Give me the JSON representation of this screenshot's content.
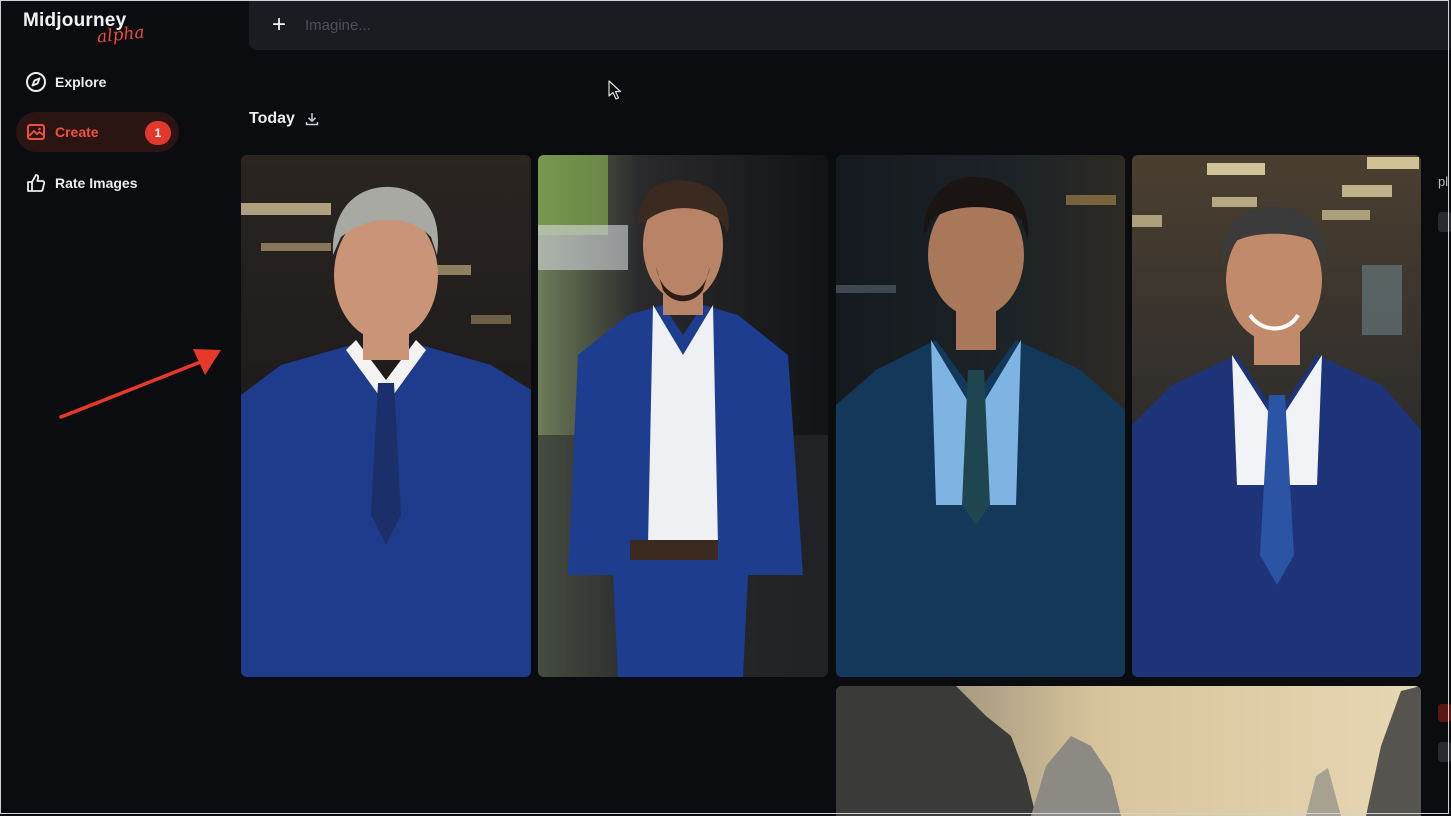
{
  "app": {
    "brand": "Midjourney",
    "badge_word": "alpha"
  },
  "sidebar": {
    "items": [
      {
        "label": "Explore",
        "icon": "compass-icon",
        "active": false
      },
      {
        "label": "Create",
        "icon": "image-icon",
        "active": true,
        "count": "1"
      },
      {
        "label": "Rate Images",
        "icon": "thumbs-up-icon",
        "active": false
      }
    ]
  },
  "prompt_bar": {
    "placeholder": "Imagine..."
  },
  "gallery": {
    "section_title": "Today",
    "download_icon": "download-icon"
  },
  "edge": {
    "partial_text": "pl"
  },
  "colors": {
    "accent": "#e2382b",
    "background": "#0b0c10",
    "prompt_bar": "#1b1c22",
    "annotation_arrow": "#e8382a"
  },
  "images": [
    {
      "name": "portrait-gray-hair-blue-suit",
      "suit": "#1f3b8c",
      "tie": "#1b2f6a",
      "shirt": "#f3f3f3",
      "hair": "#a9a9a4",
      "skin": "#c99478"
    },
    {
      "name": "portrait-beard-blue-suit",
      "suit": "#1e3d8f",
      "tie": "none",
      "shirt": "#eef0f4",
      "hair": "#3a2a20",
      "skin": "#b88366"
    },
    {
      "name": "portrait-dark-hair-teal-suit",
      "suit": "#14385a",
      "tie": "#1f4650",
      "shirt": "#7fb3e2",
      "hair": "#1a1512",
      "skin": "#a9785b"
    },
    {
      "name": "portrait-smiling-navy-suit",
      "suit": "#1e3378",
      "tie": "#2c54a5",
      "shirt": "#f1f3f6",
      "hair": "#3b3b3b",
      "skin": "#c18a6a"
    },
    {
      "name": "landscape-misty-mountains",
      "sky": "#cbb690"
    }
  ]
}
